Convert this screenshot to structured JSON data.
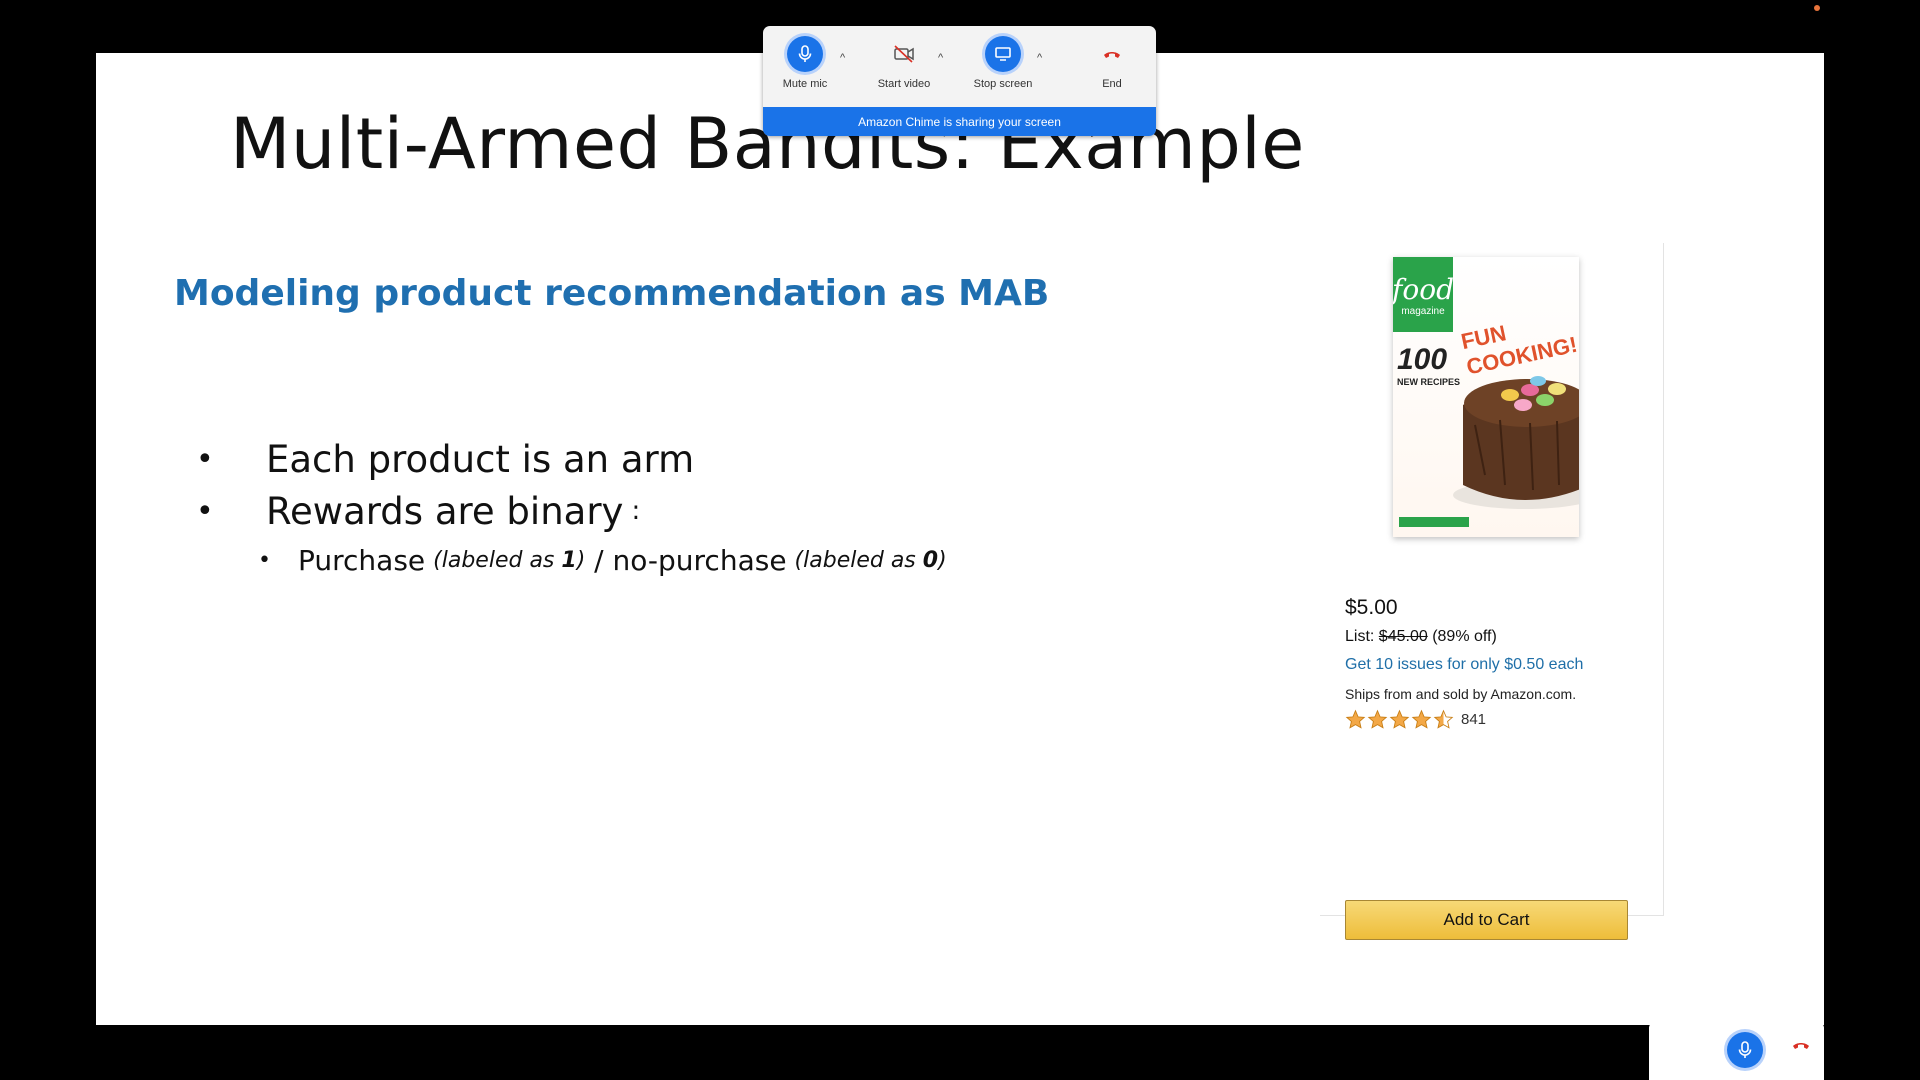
{
  "slide": {
    "title": "Multi-Armed Bandits: Example",
    "subtitle": "Modeling product recommendation as MAB",
    "bullets": [
      {
        "text": "Each product is an arm"
      },
      {
        "text": "Rewards are binary",
        "suffix": ":"
      }
    ],
    "sub_bullet": {
      "purchase": "Purchase",
      "purchase_note_prefix": "(labeled as ",
      "purchase_value": "1",
      "purchase_note_suffix": ")",
      "separator": " / ",
      "no_purchase": "no-purchase",
      "no_purchase_note_prefix": "(labeled as ",
      "no_purchase_value": "0",
      "no_purchase_note_suffix": ")"
    }
  },
  "product": {
    "cover": {
      "brand": "food",
      "brand_sub": "magazine",
      "headline": "FUN COOKING!",
      "count": "100",
      "count_sub": "NEW RECIPES"
    },
    "price": "$5.00",
    "list_label": "List:",
    "list_price": "$45.00",
    "discount": "(89% off)",
    "offer": "Get 10 issues for only $0.50 each",
    "ships": "Ships from and sold by Amazon.com.",
    "rating": 4.5,
    "review_count": "841",
    "add_to_cart": "Add to Cart"
  },
  "chime": {
    "mute_label": "Mute mic",
    "video_label": "Start video",
    "screen_label": "Stop screen",
    "end_label": "End",
    "sharing_text": "Amazon Chime is sharing your screen"
  },
  "colors": {
    "subtitle": "#1f6fb0",
    "link": "#1f6fa8",
    "chime_blue": "#1a73e8",
    "end_red": "#d93025",
    "star": "#f3a847"
  }
}
